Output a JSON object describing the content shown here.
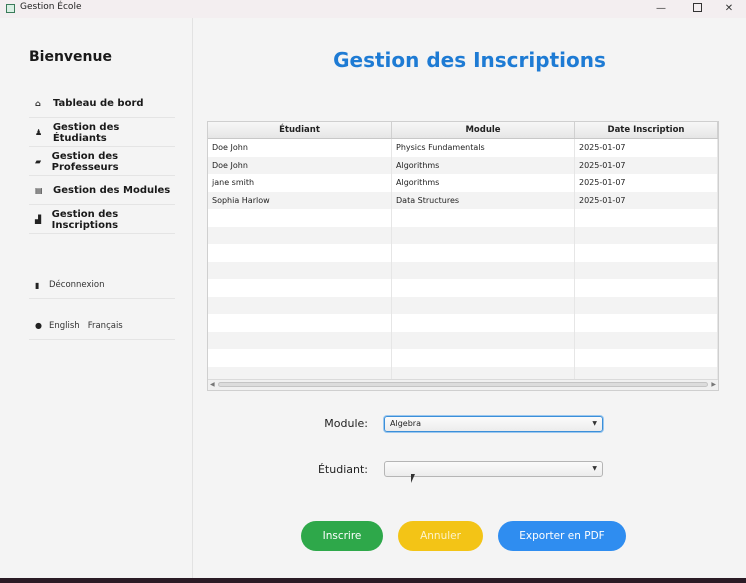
{
  "window": {
    "title": "Gestion École",
    "min_glyph": "—",
    "close_glyph": "✕"
  },
  "sidebar": {
    "welcome": "Bienvenue",
    "items": [
      {
        "label": "Tableau de bord",
        "icon": "home-icon",
        "glyph": "⌂"
      },
      {
        "label": "Gestion des Étudiants",
        "icon": "student-icon",
        "glyph": "♟"
      },
      {
        "label": "Gestion des Professeurs",
        "icon": "teacher-icon",
        "glyph": "▰"
      },
      {
        "label": "Gestion des Modules",
        "icon": "book-icon",
        "glyph": "▤"
      },
      {
        "label": "Gestion des Inscriptions",
        "icon": "enroll-icon",
        "glyph": "▟"
      }
    ],
    "logout": {
      "label": "Déconnexion",
      "icon": "logout-icon",
      "glyph": "▮"
    },
    "languages": {
      "icon": "globe-icon",
      "glyph": "●",
      "options": [
        "English",
        "Français"
      ]
    }
  },
  "main": {
    "title": "Gestion des Inscriptions",
    "table": {
      "columns": [
        "Étudiant",
        "Module",
        "Date Inscription"
      ],
      "rows": [
        [
          "Doe John",
          "Physics Fundamentals",
          "2025-01-07"
        ],
        [
          "Doe John",
          "Algorithms",
          "2025-01-07"
        ],
        [
          "jane smith",
          "Algorithms",
          "2025-01-07"
        ],
        [
          "Sophia  Harlow",
          "Data Structures",
          "2025-01-07"
        ]
      ],
      "empty_rows": 10
    },
    "form": {
      "module_label": "Module:",
      "module_value": "Algebra",
      "student_label": "Étudiant:",
      "student_value": ""
    },
    "buttons": {
      "inscrire": "Inscrire",
      "annuler": "Annuler",
      "export": "Exporter en PDF"
    }
  },
  "colors": {
    "title_blue": "#1e7bd4",
    "green": "#2ea84a",
    "yellow": "#f3c416",
    "blue": "#2f8df0"
  }
}
